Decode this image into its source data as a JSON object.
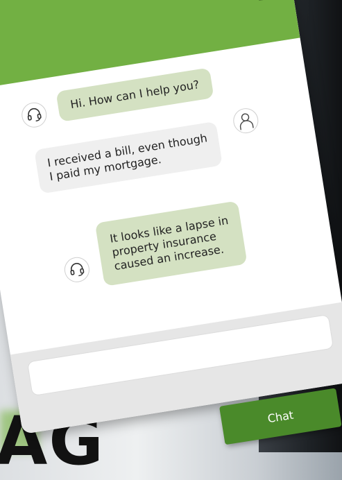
{
  "chat": {
    "messages": [
      {
        "from": "agent",
        "text": "Hi. How can I help you?"
      },
      {
        "from": "user",
        "lines": [
          "I received a bill, even though",
          "I paid my mortgage."
        ]
      },
      {
        "from": "agent",
        "lines": [
          "It looks like a lapse in",
          "property insurance",
          "caused an increase."
        ]
      }
    ]
  },
  "composer": {
    "placeholder": "",
    "send_label": "Chat"
  },
  "background_text": "AG",
  "colors": {
    "header": "#72b043",
    "agent_bubble": "#d4e1c2",
    "user_bubble": "#efefef",
    "send_button": "#4a8a2a"
  },
  "icons": {
    "agent_avatar": "headset-icon",
    "user_avatar": "person-icon",
    "menu": "menu-icon"
  }
}
